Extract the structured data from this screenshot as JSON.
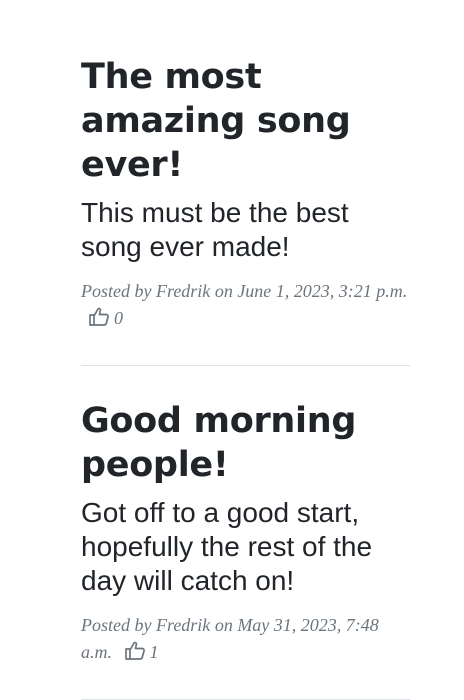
{
  "posts": [
    {
      "title": "The most amazing song ever!",
      "subtitle": "This must be the best song ever made!",
      "posted_by_prefix": "Posted by ",
      "author": "Fredrik",
      "on": " on ",
      "date": "June 1, 2023, 3:21 p.m.",
      "likes": "0",
      "like_icon": "thumbs-up-icon"
    },
    {
      "title": "Good morning people!",
      "subtitle": "Got off to a good start, hopefully the rest of the day will catch on!",
      "posted_by_prefix": "Posted by ",
      "author": "Fredrik",
      "on": " on ",
      "date": "May 31, 2023, 7:48 a.m.",
      "likes": "1",
      "like_icon": "thumbs-up-icon"
    }
  ],
  "colors": {
    "text": "#212529",
    "meta": "#6c757d",
    "divider": "#dee2e6"
  }
}
